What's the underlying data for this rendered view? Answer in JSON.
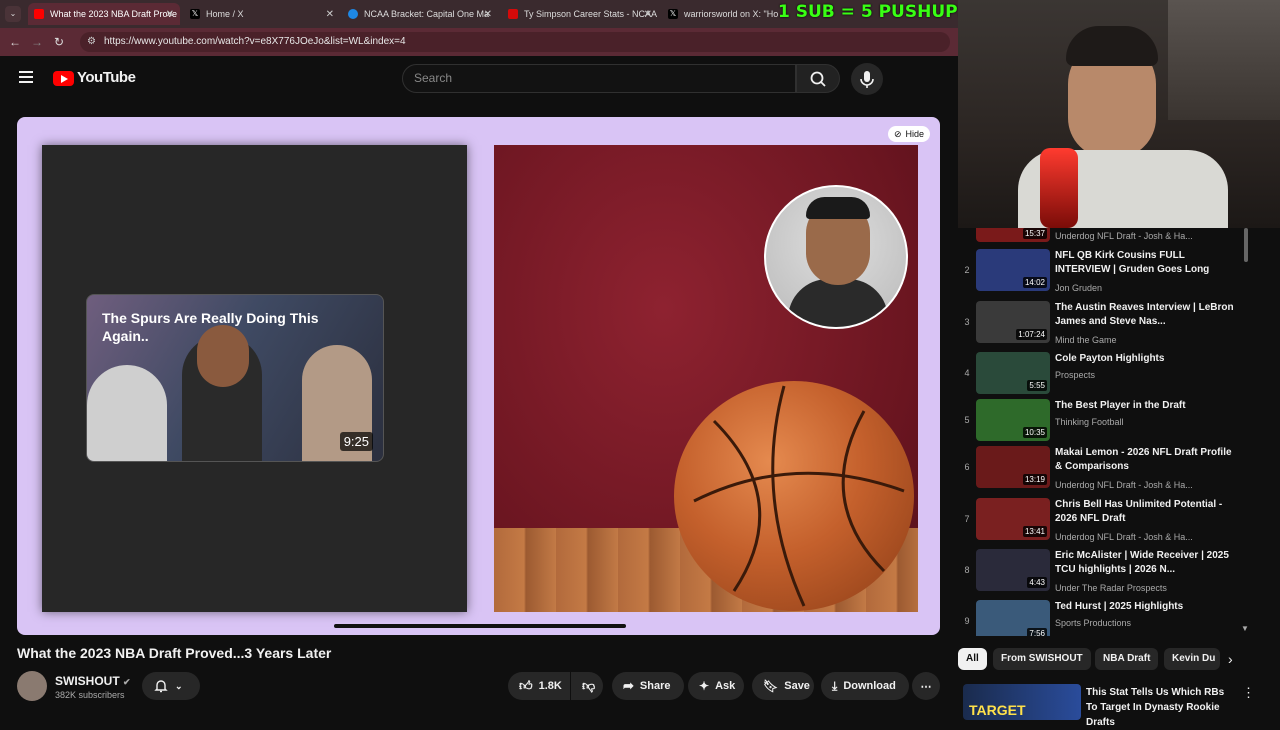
{
  "browser": {
    "tabs": [
      {
        "label": "What the 2023 NBA Draft Prove",
        "color": "#ff0000",
        "active": true
      },
      {
        "label": "Home / X",
        "color": "#000000"
      },
      {
        "label": "NCAA Bracket: Capital One Ma",
        "color": "#1e88e5"
      },
      {
        "label": "Ty Simpson Career Stats - NCAA",
        "color": "#d50a0a"
      },
      {
        "label": "warriorsworld on X: \"How? h",
        "color": "#000000"
      }
    ],
    "url": "https://www.youtube.com/watch?v=e8X776JOeJo&list=WL&index=4"
  },
  "stream_overlay": "1 SUB = 5 PUSHUPS",
  "header": {
    "logo": "YouTube",
    "search_placeholder": "Search"
  },
  "player": {
    "hide_label": "Hide",
    "thumbnail_title": "The Spurs Are Really Doing This Again..",
    "thumbnail_duration": "9:25"
  },
  "video": {
    "title": "What the 2023 NBA Draft Proved...3 Years Later",
    "channel": "SWISHOUT",
    "subscribers": "382K subscribers",
    "likes": "1.8K",
    "share": "Share",
    "ask": "Ask",
    "save": "Save",
    "download": "Download"
  },
  "playlist": [
    {
      "num": "",
      "title": "",
      "channel": "Underdog NFL Draft - Josh & Ha...",
      "duration": "15:37",
      "thumb": "#7a1a1a"
    },
    {
      "num": "2",
      "title": "NFL QB Kirk Cousins FULL INTERVIEW | Gruden Goes Long",
      "channel": "Jon Gruden",
      "duration": "14:02",
      "thumb": "#2a3a7a"
    },
    {
      "num": "3",
      "title": "The Austin Reaves Interview | LeBron James and Steve Nas...",
      "channel": "Mind the Game",
      "duration": "1:07:24",
      "thumb": "#3a3a3a"
    },
    {
      "num": "4",
      "title": "Cole Payton Highlights",
      "channel": "Prospects",
      "duration": "5:55",
      "thumb": "#2a4a3a"
    },
    {
      "num": "5",
      "title": "The Best Player in the Draft",
      "channel": "Thinking Football",
      "duration": "10:35",
      "thumb": "#2e6a2a"
    },
    {
      "num": "6",
      "title": "Makai Lemon - 2026 NFL Draft Profile & Comparisons",
      "channel": "Underdog NFL Draft - Josh & Ha...",
      "duration": "13:19",
      "thumb": "#6a1a1a"
    },
    {
      "num": "7",
      "title": "Chris Bell Has Unlimited Potential - 2026 NFL Draft",
      "channel": "Underdog NFL Draft - Josh & Ha...",
      "duration": "13:41",
      "thumb": "#7a2020"
    },
    {
      "num": "8",
      "title": "Eric McAlister | Wide Receiver | 2025 TCU highlights | 2026 N...",
      "channel": "Under The Radar Prospects",
      "duration": "4:43",
      "thumb": "#2a2a3a"
    },
    {
      "num": "9",
      "title": "Ted Hurst | 2025 Highlights",
      "channel": "Sports Productions",
      "duration": "7:56",
      "thumb": "#3a5a7a"
    }
  ],
  "chips": [
    "All",
    "From SWISHOUT",
    "NBA Draft",
    "Kevin Du"
  ],
  "recommended": {
    "title": "This Stat Tells Us Which RBs To Target In Dynasty Rookie Drafts",
    "thumb_text": "TARGET"
  }
}
